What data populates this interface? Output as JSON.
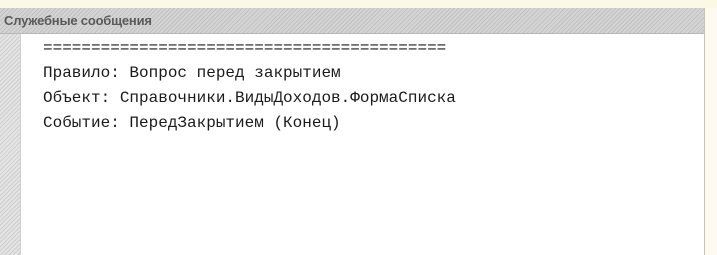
{
  "panel": {
    "title": "Служебные сообщения"
  },
  "messages": [
    "==========================================",
    "Правило: Вопрос перед закрытием",
    "Объект: Справочники.ВидыДоходов.ФормаСписка",
    "Событие: ПередЗакрытием (Конец)"
  ]
}
